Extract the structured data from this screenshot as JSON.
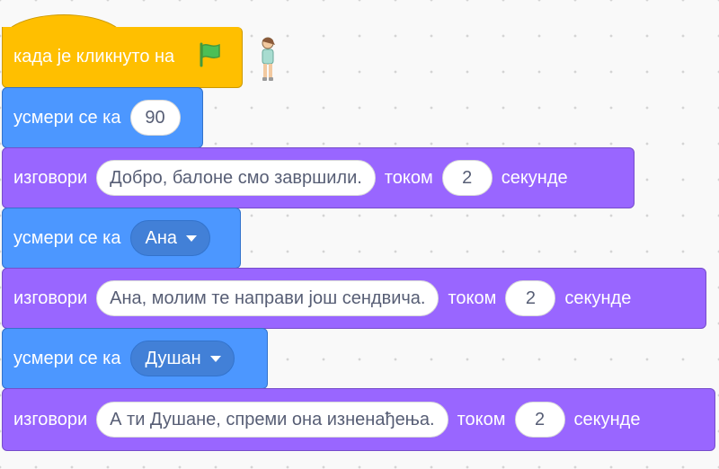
{
  "script": {
    "hat": {
      "label": "када је кликнуто на",
      "icon": "green-flag-icon"
    },
    "blocks": [
      {
        "type": "motion",
        "label": "усмери се ка",
        "value": "90"
      },
      {
        "type": "looks",
        "label": "изговори",
        "message": "Добро, балоне смо завршили.",
        "for_label": "током",
        "secs": "2",
        "unit": "секунде"
      },
      {
        "type": "motion",
        "label": "усмери се ка",
        "target": "Ана"
      },
      {
        "type": "looks",
        "label": "изговори",
        "message": "Ана, молим те направи још сендвича.",
        "for_label": "током",
        "secs": "2",
        "unit": "секунде"
      },
      {
        "type": "motion",
        "label": "усмери се ка",
        "target": "Душан"
      },
      {
        "type": "looks",
        "label": "изговори",
        "message": "А ти Душане, спреми она изненађења.",
        "for_label": "током",
        "secs": "2",
        "unit": "секунде"
      }
    ]
  },
  "colors": {
    "event": "#ffbf00",
    "motion": "#4c97ff",
    "looks": "#9966ff",
    "flag": "#4cbf56"
  },
  "sprite": {
    "icon": "sprite-girl-icon"
  }
}
